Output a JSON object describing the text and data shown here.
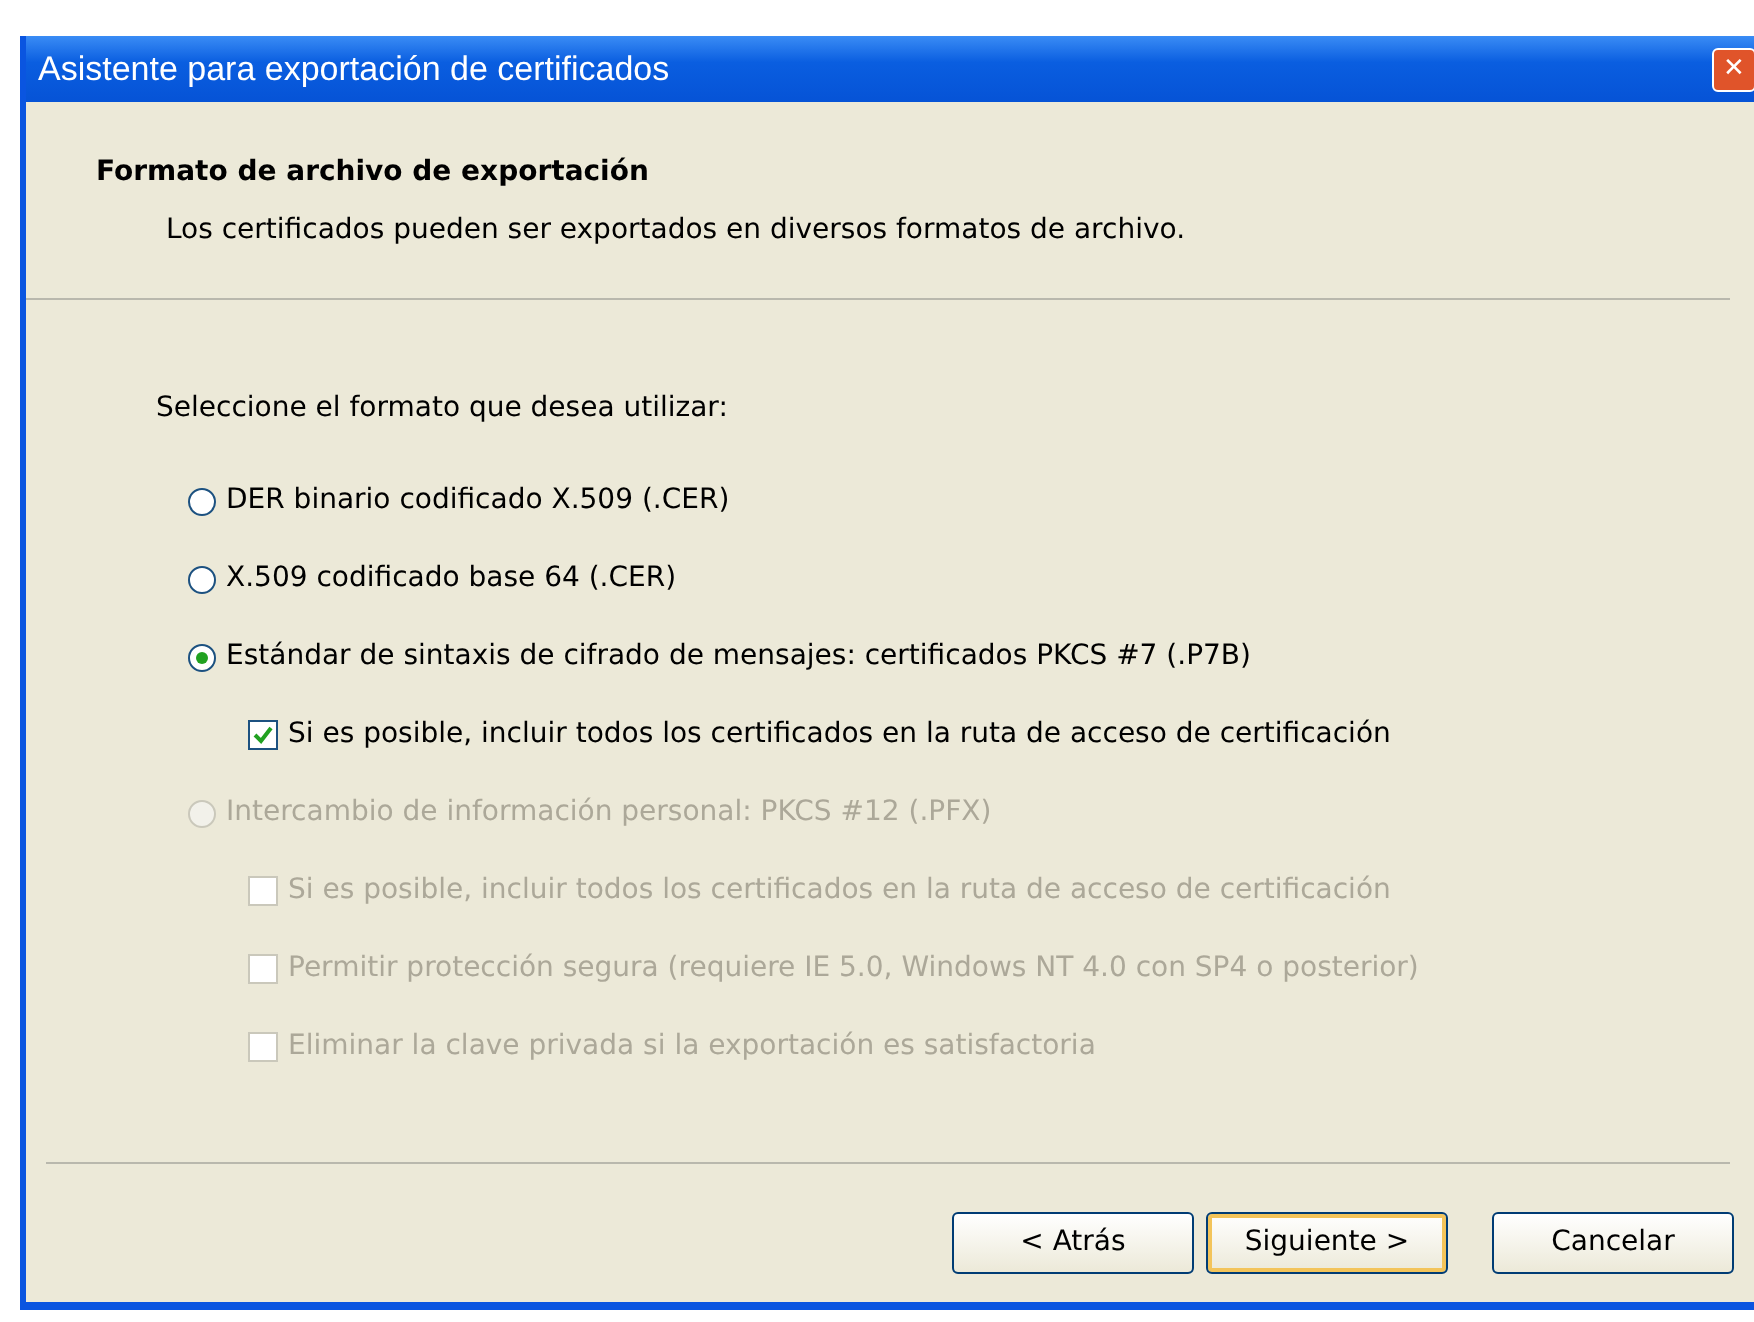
{
  "window": {
    "title": "Asistente para exportación de certificados",
    "close": "✕"
  },
  "header": {
    "title": "Formato de archivo de exportación",
    "subtitle": "Los certificados pueden ser exportados en diversos formatos de archivo."
  },
  "prompt": "Seleccione el formato que desea utilizar:",
  "options": [
    {
      "kind": "radio",
      "label": "DER binario codificado X.509 (.CER)",
      "selected": false,
      "disabled": false
    },
    {
      "kind": "radio",
      "label": "X.509 codificado base 64 (.CER)",
      "selected": false,
      "disabled": false
    },
    {
      "kind": "radio",
      "label": "Estándar de sintaxis de cifrado de mensajes: certificados PKCS #7 (.P7B)",
      "selected": true,
      "disabled": false,
      "children": [
        {
          "kind": "checkbox",
          "label": "Si es posible, incluir todos los certificados en la ruta de acceso de certificación",
          "checked": true,
          "disabled": false
        }
      ]
    },
    {
      "kind": "radio",
      "label": "Intercambio de información personal: PKCS #12 (.PFX)",
      "selected": false,
      "disabled": true,
      "children": [
        {
          "kind": "checkbox",
          "label": "Si es posible, incluir todos los certificados en la ruta de acceso de certificación",
          "checked": false,
          "disabled": true
        },
        {
          "kind": "checkbox",
          "label": "Permitir protección segura (requiere IE 5.0, Windows NT 4.0 con SP4 o posterior)",
          "checked": false,
          "disabled": true
        },
        {
          "kind": "checkbox",
          "label": "Eliminar la clave privada si la exportación es satisfactoria",
          "checked": false,
          "disabled": true
        }
      ]
    }
  ],
  "buttons": [
    {
      "label": "< Atrás",
      "default": false
    },
    {
      "label": "Siguiente >",
      "default": true
    },
    {
      "label": "Cancelar",
      "default": false
    }
  ]
}
